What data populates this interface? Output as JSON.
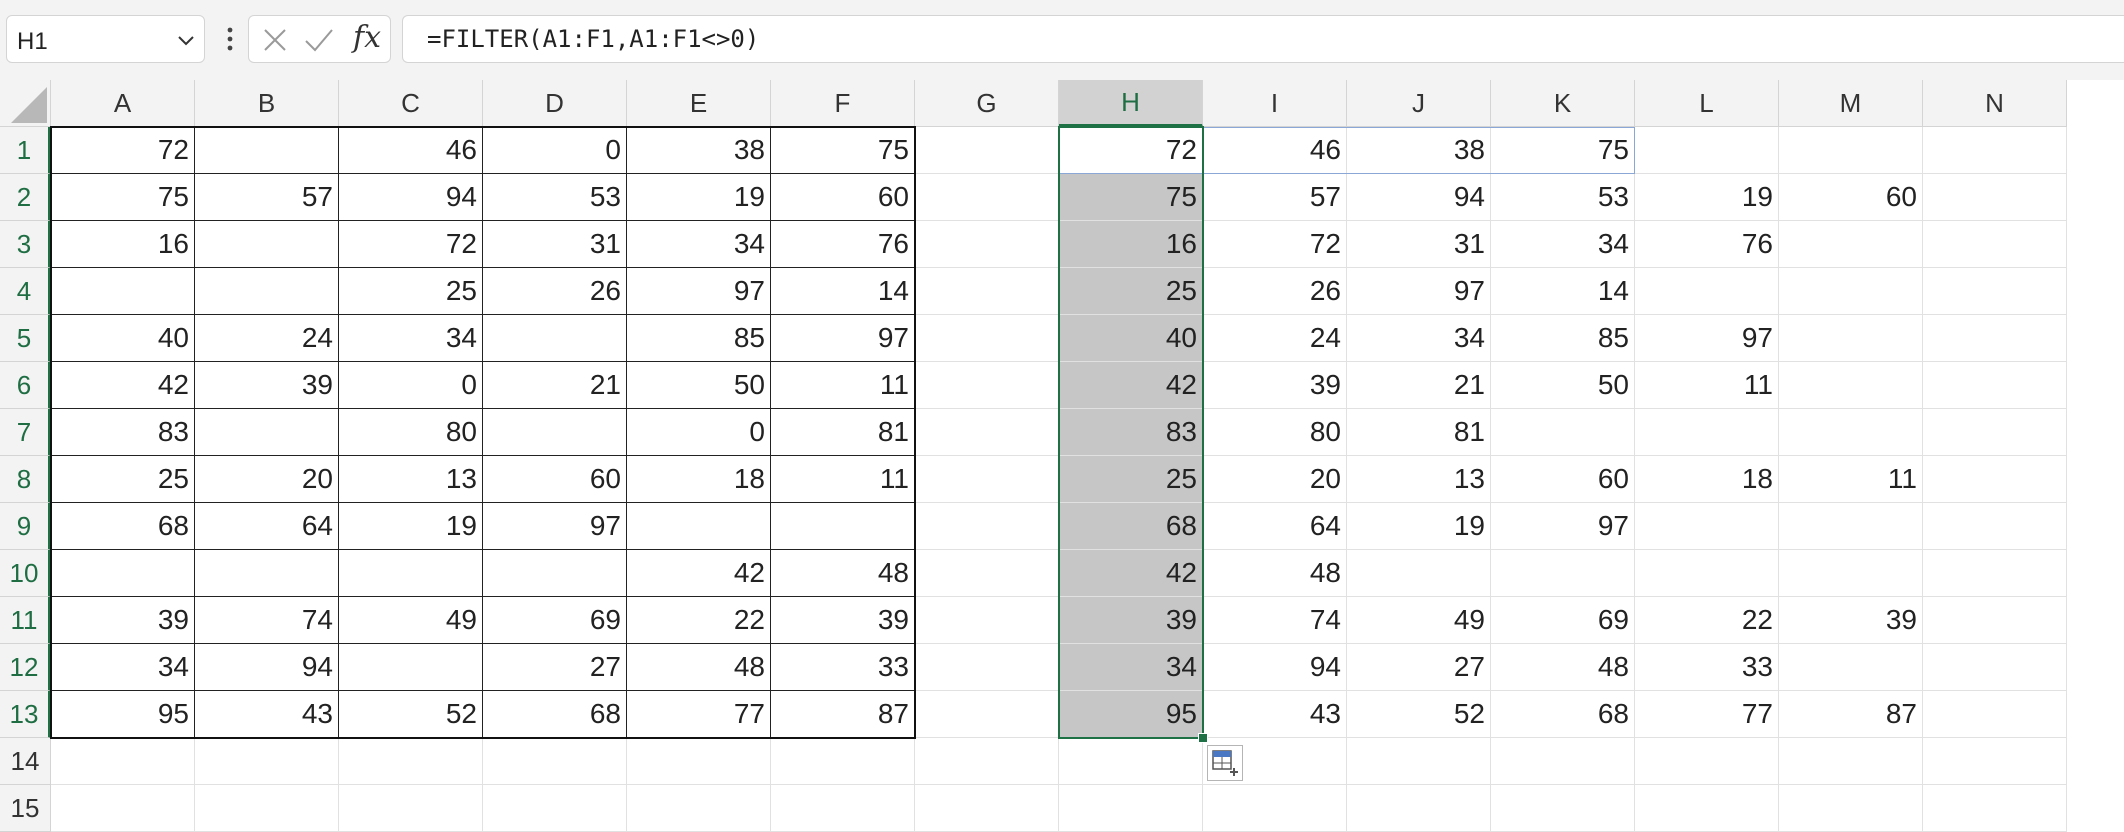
{
  "name_box": {
    "value": "H1"
  },
  "formula_bar": {
    "formula": "=FILTER(A1:F1,A1:F1<>0)"
  },
  "icons": {
    "name_box_dropdown": "chevron-down-icon",
    "more": "vertical-ellipsis-icon",
    "cancel": "close-icon",
    "enter": "checkmark-icon",
    "insert_function": "fx-icon",
    "quick_analysis": "quick-analysis-icon"
  },
  "fx_label": "fx",
  "colors": {
    "selection": "#1e7145",
    "selected_range_fill": "#c6c6c6",
    "spill_outline": "#8aa7d6"
  },
  "columns": [
    "A",
    "B",
    "C",
    "D",
    "E",
    "F",
    "G",
    "H",
    "I",
    "J",
    "K",
    "L",
    "M",
    "N"
  ],
  "rows": [
    "1",
    "2",
    "3",
    "4",
    "5",
    "6",
    "7",
    "8",
    "9",
    "10",
    "11",
    "12",
    "13",
    "14",
    "15"
  ],
  "cells": [
    [
      "72",
      "",
      "46",
      "0",
      "38",
      "75",
      "",
      "72",
      "46",
      "38",
      "75",
      "",
      "",
      ""
    ],
    [
      "75",
      "57",
      "94",
      "53",
      "19",
      "60",
      "",
      "75",
      "57",
      "94",
      "53",
      "19",
      "60",
      ""
    ],
    [
      "16",
      "",
      "72",
      "31",
      "34",
      "76",
      "",
      "16",
      "72",
      "31",
      "34",
      "76",
      "",
      ""
    ],
    [
      "",
      "",
      "25",
      "26",
      "97",
      "14",
      "",
      "25",
      "26",
      "97",
      "14",
      "",
      "",
      ""
    ],
    [
      "40",
      "24",
      "34",
      "",
      "85",
      "97",
      "",
      "40",
      "24",
      "34",
      "85",
      "97",
      "",
      ""
    ],
    [
      "42",
      "39",
      "0",
      "21",
      "50",
      "11",
      "",
      "42",
      "39",
      "21",
      "50",
      "11",
      "",
      ""
    ],
    [
      "83",
      "",
      "80",
      "",
      "0",
      "81",
      "",
      "83",
      "80",
      "81",
      "",
      "",
      "",
      ""
    ],
    [
      "25",
      "20",
      "13",
      "60",
      "18",
      "11",
      "",
      "25",
      "20",
      "13",
      "60",
      "18",
      "11",
      ""
    ],
    [
      "68",
      "64",
      "19",
      "97",
      "",
      "",
      "",
      "68",
      "64",
      "19",
      "97",
      "",
      "",
      ""
    ],
    [
      "",
      "",
      "",
      "",
      "42",
      "48",
      "",
      "42",
      "48",
      "",
      "",
      "",
      "",
      ""
    ],
    [
      "39",
      "74",
      "49",
      "69",
      "22",
      "39",
      "",
      "39",
      "74",
      "49",
      "69",
      "22",
      "39",
      ""
    ],
    [
      "34",
      "94",
      "",
      "27",
      "48",
      "33",
      "",
      "34",
      "94",
      "27",
      "48",
      "33",
      "",
      ""
    ],
    [
      "95",
      "43",
      "52",
      "68",
      "77",
      "87",
      "",
      "95",
      "43",
      "52",
      "68",
      "77",
      "87",
      ""
    ],
    [
      "",
      "",
      "",
      "",
      "",
      "",
      "",
      "",
      "",
      "",
      "",
      "",
      "",
      ""
    ],
    [
      "",
      "",
      "",
      "",
      "",
      "",
      "",
      "",
      "",
      "",
      "",
      "",
      "",
      ""
    ]
  ],
  "selection": {
    "active_cell": "H1",
    "range": "H1:H13",
    "selected_column": "H",
    "selected_rows": [
      "1",
      "2",
      "3",
      "4",
      "5",
      "6",
      "7",
      "8",
      "9",
      "10",
      "11",
      "12",
      "13"
    ]
  }
}
